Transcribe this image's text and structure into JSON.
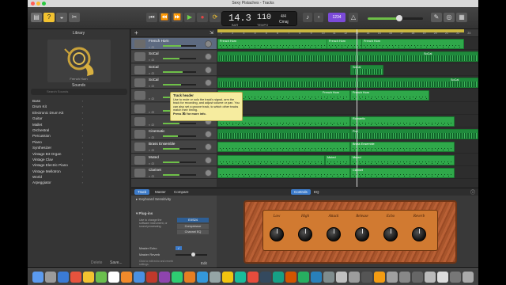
{
  "window": {
    "title": "Sexy Pistaches - Tracks"
  },
  "control_bar": {
    "lcd": {
      "bar": "14.3",
      "bar_sub": "BAR",
      "tempo": "110",
      "tempo_sub": "TEMPO",
      "signature": "4/4",
      "key": "Cmaj"
    },
    "badge": "1234"
  },
  "library": {
    "title": "Library",
    "instrument_name": "French Horn",
    "sounds_label": "Sounds",
    "search_placeholder": "Search Sounds",
    "items": [
      "Bass",
      "Drum Kit",
      "Electronic Drum Kit",
      "Guitar",
      "Mallet",
      "Orchestral",
      "Percussion",
      "Piano",
      "Synthesizer",
      "Vintage B3 Organ",
      "Vintage Clav",
      "Vintage Electric Piano",
      "Vintage Mellotron",
      "World",
      "Arpeggiator"
    ],
    "delete_label": "Delete",
    "save_label": "Save..."
  },
  "tracks": [
    {
      "name": "French Horn",
      "selected": true,
      "vol": 0.55
    },
    {
      "name": "SoCal",
      "selected": false,
      "vol": 0.5
    },
    {
      "name": "SoCal",
      "selected": false,
      "vol": 0.6
    },
    {
      "name": "SoCal",
      "selected": false,
      "vol": 0.55
    },
    {
      "name": "",
      "selected": false,
      "vol": 0.5
    },
    {
      "name": "",
      "selected": false,
      "vol": 0.5
    },
    {
      "name": "",
      "selected": false,
      "vol": 0.5
    },
    {
      "name": "Cinematic",
      "selected": false,
      "vol": 0.45
    },
    {
      "name": "Brass Ensemble",
      "selected": false,
      "vol": 0.5
    },
    {
      "name": "Muted",
      "selected": false,
      "vol": 0.5
    },
    {
      "name": "Clarinet",
      "selected": false,
      "vol": 0.5
    }
  ],
  "tooltip": {
    "title": "Track header",
    "body": "Use to mute or solo the track's signal, arm the track for recording, and adjust volume or pan. You can also set a groove track, to which other tracks match their timing.",
    "more": "Press ⌘/ for more info."
  },
  "ruler_ticks": [
    "1",
    "2",
    "3",
    "4",
    "5",
    "6",
    "7",
    "8",
    "9",
    "10",
    "11",
    "12",
    "13",
    "14",
    "15",
    "16",
    "17",
    "18",
    "19",
    "20",
    "21",
    "22",
    "23"
  ],
  "regions": [
    {
      "lane": 0,
      "name": "French Horn",
      "start": 0,
      "end": 312,
      "type": "midi",
      "label_at": 0
    },
    {
      "lane": 0,
      "name": "French Horn",
      "start": 138,
      "end": 312,
      "type": "midi-label",
      "label_at": 138
    },
    {
      "lane": 0,
      "name": "French Horn",
      "start": 182,
      "end": 312,
      "type": "midi-label",
      "label_at": 182
    },
    {
      "lane": 1,
      "name": "SoCal",
      "start": 0,
      "end": 330,
      "type": "audio",
      "label_at": 258
    },
    {
      "lane": 2,
      "name": "SoCal",
      "start": 168,
      "end": 210,
      "type": "audio",
      "label_at": 168
    },
    {
      "lane": 3,
      "name": "SoCal",
      "start": 0,
      "end": 330,
      "type": "audio",
      "label_at": 292
    },
    {
      "lane": 4,
      "name": "French Horn",
      "start": 0,
      "end": 168,
      "type": "midi",
      "label_at": 130
    },
    {
      "lane": 4,
      "name": "French Horn",
      "start": 168,
      "end": 268,
      "type": "midi",
      "label_at": 168
    },
    {
      "lane": 6,
      "name": "",
      "start": 0,
      "end": 168,
      "type": "midi",
      "label_at": 0
    },
    {
      "lane": 6,
      "name": "Romantic",
      "start": 168,
      "end": 300,
      "type": "midi",
      "label_at": 168
    },
    {
      "lane": 7,
      "name": "Pop",
      "start": 168,
      "end": 330,
      "type": "audio",
      "label_at": 168
    },
    {
      "lane": 7,
      "name": "",
      "start": 0,
      "end": 168,
      "type": "audio",
      "label_at": 0
    },
    {
      "lane": 8,
      "name": "Brass Ensemble",
      "start": 168,
      "end": 300,
      "type": "midi",
      "label_at": 168
    },
    {
      "lane": 8,
      "name": "",
      "start": 0,
      "end": 168,
      "type": "midi",
      "label_at": 0
    },
    {
      "lane": 9,
      "name": "Muted",
      "start": 136,
      "end": 168,
      "type": "midi",
      "label_at": 136
    },
    {
      "lane": 9,
      "name": "Muted",
      "start": 168,
      "end": 300,
      "type": "midi",
      "label_at": 168
    },
    {
      "lane": 9,
      "name": "",
      "start": 0,
      "end": 136,
      "type": "midi",
      "label_at": 0
    },
    {
      "lane": 10,
      "name": "Clarinet",
      "start": 168,
      "end": 300,
      "type": "midi",
      "label_at": 168
    },
    {
      "lane": 10,
      "name": "",
      "start": 0,
      "end": 168,
      "type": "midi",
      "label_at": 0
    }
  ],
  "editor": {
    "tabs": [
      "Track",
      "Master",
      "Compare"
    ],
    "center_tabs": [
      "Controls",
      "EQ"
    ],
    "keyboard_sensitivity": "Keyboard Sensitivity",
    "plugins_label": "Plug-ins",
    "plugins_help": "Use to change the software instrument, or sound processing.",
    "plugin_slots": [
      "EXS24",
      "Compressor",
      "Channel EQ"
    ],
    "master_echo": "Master Echo",
    "master_reverb": "Master Reverb",
    "edit_help": "Click to edit echo and reverb settings.",
    "edit_label": "Edit",
    "knobs": [
      "Low",
      "High",
      "Attack",
      "Release",
      "Echo",
      "Reverb"
    ]
  },
  "colors": {
    "region_green": "#2fa84a",
    "selected_track": "#5d6a80",
    "tooltip_bg": "#f6ec9f",
    "amp_panel": "#d17a31"
  }
}
